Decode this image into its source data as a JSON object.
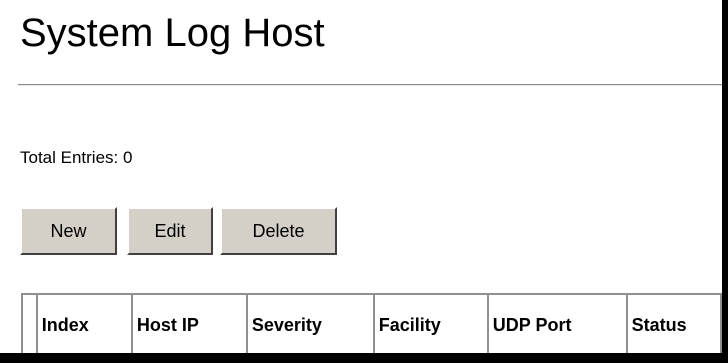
{
  "page": {
    "title": "System Log Host",
    "total_entries_label": "Total Entries: 0"
  },
  "toolbar": {
    "new_label": "New",
    "edit_label": "Edit",
    "delete_label": "Delete"
  },
  "table": {
    "columns": [
      "",
      "Index",
      "Host IP",
      "Severity",
      "Facility",
      "UDP Port",
      "Status"
    ],
    "rows": []
  }
}
